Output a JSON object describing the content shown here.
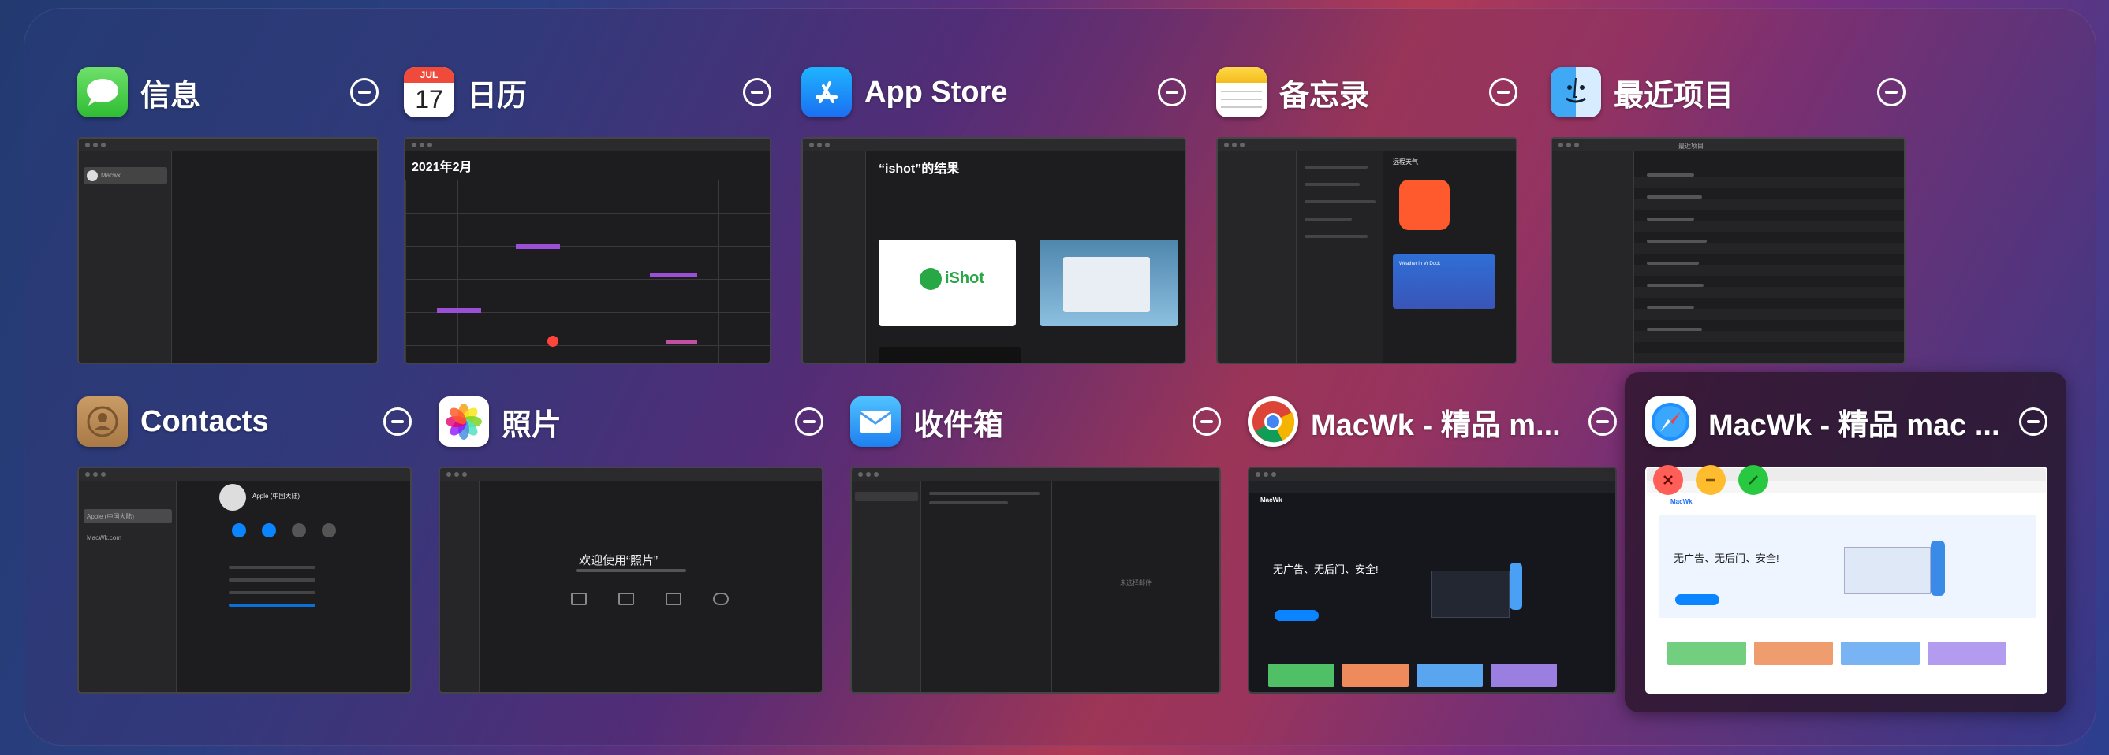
{
  "windows": [
    {
      "id": "messages",
      "title": "信息",
      "thumb_text": "Macwk"
    },
    {
      "id": "calendar",
      "title": "日历",
      "icon_month": "JUL",
      "icon_day": "17",
      "thumb_text": "2021年2月"
    },
    {
      "id": "appstore",
      "title": "App Store",
      "thumb_text": "“ishot”的结果",
      "thumb_brand": "iShot"
    },
    {
      "id": "notes",
      "title": "备忘录",
      "thumb_text": "远程天气",
      "thumb_sub": "Weather In Vr Dock"
    },
    {
      "id": "finder",
      "title": "最近项目",
      "thumb_text": "最近项目"
    },
    {
      "id": "contacts",
      "title": "Contacts",
      "thumb_text": "Apple (中国大陆)",
      "thumb_sub": "MacWk.com"
    },
    {
      "id": "photos",
      "title": "照片",
      "thumb_text": "欢迎使用“照片”"
    },
    {
      "id": "mail",
      "title": "收件箱",
      "thumb_text": "未选择邮件"
    },
    {
      "id": "chrome",
      "title": "MacWk - 精品 m...",
      "thumb_text": "无广告、无后门、安全!",
      "thumb_brand": "MacWk"
    },
    {
      "id": "safari",
      "title": "MacWk - 精品 mac ...",
      "thumb_text": "无广告、无后门、安全!",
      "thumb_brand": "MacWk"
    }
  ],
  "colors": {
    "close": "#ff5f57",
    "minimize": "#febc2e",
    "zoom": "#28c840"
  }
}
